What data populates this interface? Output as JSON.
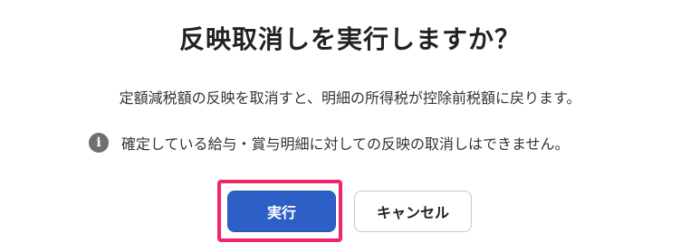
{
  "dialog": {
    "title": "反映取消しを実行しますか？",
    "description": "定額減税額の反映を取消すと、明細の所得税が控除前税額に戻ります。",
    "notice": {
      "icon": "info-icon",
      "text": "確定している給与・賞与明細に対しての反映の取消しはできません。"
    },
    "buttons": {
      "execute_label": "実行",
      "cancel_label": "キャンセル"
    }
  },
  "colors": {
    "primary": "#2d5fc7",
    "highlight": "#f0266b",
    "info_icon": "#6f6f6f"
  }
}
